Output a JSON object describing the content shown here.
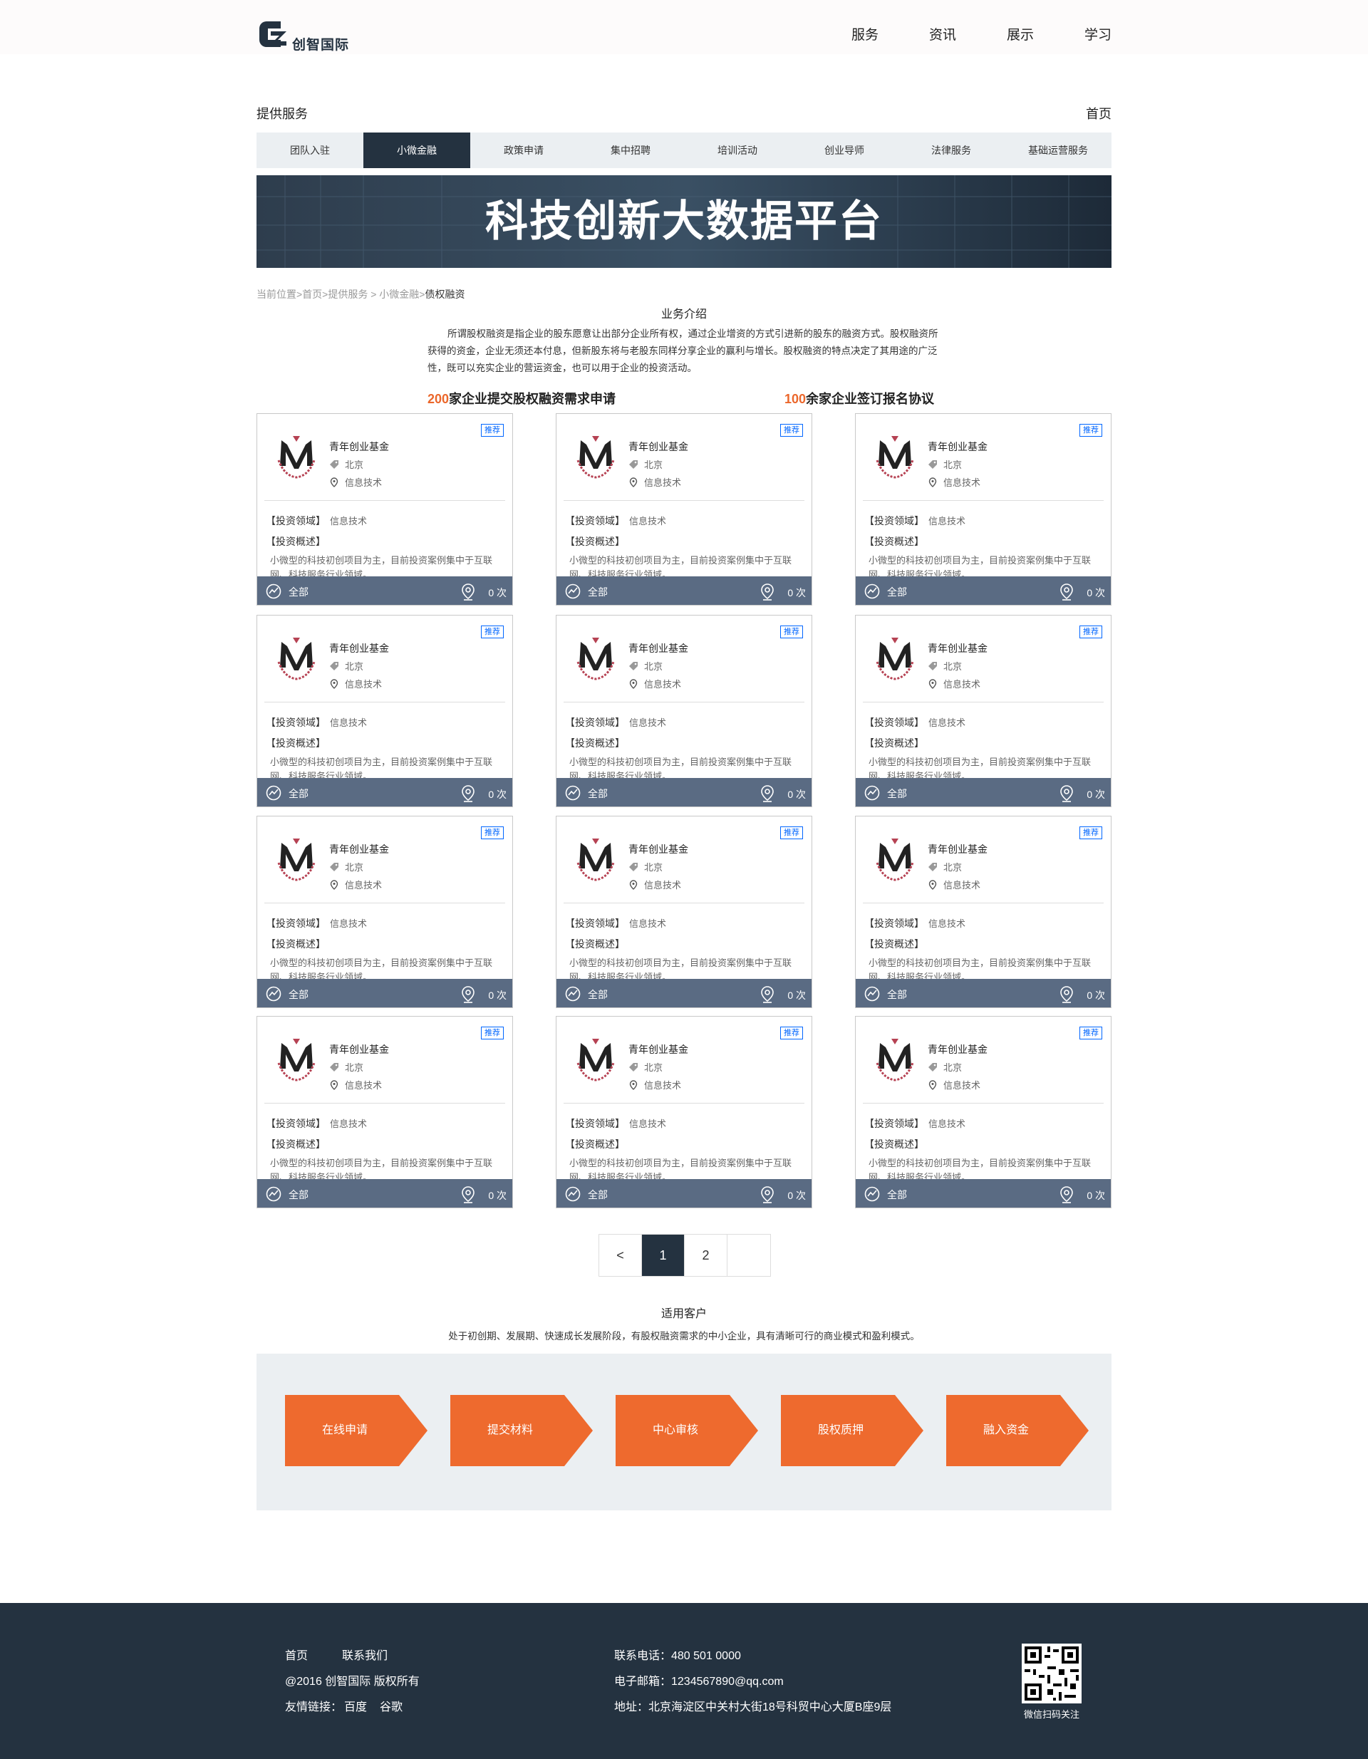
{
  "header": {
    "logo_text": "创智国际",
    "nav": [
      "服务",
      "资讯",
      "展示",
      "学习"
    ]
  },
  "section": {
    "left_label": "提供服务",
    "right_label": "首页"
  },
  "tabs": [
    "团队入驻",
    "小微金融",
    "政策申请",
    "集中招聘",
    "培训活动",
    "创业导师",
    "法律服务",
    "基础运营服务"
  ],
  "banner": {
    "title": "科技创新大数据平台"
  },
  "breadcrumb": {
    "trail": "当前位置>首页>提供服务 > 小微金融>",
    "current": "债权融资"
  },
  "intro": {
    "title": "业务介绍",
    "text": "所谓股权融资是指企业的股东愿意让出部分企业所有权，通过企业增资的方式引进新的股东的融资方式。股权融资所获得的资金，企业无须还本付息，但新股东将与老股东同样分享企业的赢利与增长。股权融资的特点决定了其用途的广泛性，既可以充实企业的营运资金，也可以用于企业的投资活动。"
  },
  "stats": [
    {
      "num": "200",
      "text": "家企业提交股权融资需求申请"
    },
    {
      "num": "100",
      "text": "余家企业签订报名协议"
    }
  ],
  "card": {
    "badge": "推荐",
    "name": "青年创业基金",
    "location": "北京",
    "industry": "信息技术",
    "field_label": "【投资领域】",
    "field_value": "信息技术",
    "overview_label": "【投资概述】",
    "desc": "小微型的科技初创项目为主，目前投资案例集中于互联网、科技服务行业领域。",
    "foot_all": "全部",
    "foot_count": "0 次"
  },
  "pagination": {
    "prev": "<",
    "pages": [
      "1",
      "2"
    ],
    "current": "1"
  },
  "customers": {
    "title": "适用客户",
    "text": "处于初创期、发展期、快速成长发展阶段，有股权融资需求的中小企业，具有清晰可行的商业模式和盈利模式。"
  },
  "process": [
    "在线申请",
    "提交材料",
    "中心审核",
    "股权质押",
    "融入资金"
  ],
  "footer": {
    "links": [
      "首页",
      "联系我们"
    ],
    "copyright": "@2016 创智国际 版权所有",
    "friend_links_label": "友情链接：",
    "friend_links": [
      "百度",
      "谷歌"
    ],
    "phone": "联系电话：480 501 0000",
    "email": "电子邮箱：1234567890@qq.com",
    "address": "地址：北京海淀区中关村大街18号科贸中心大厦B座9层",
    "qr_caption": "微信扫码关注"
  },
  "colors": {
    "header_bg": "#fdfbfb",
    "dark": "#243240",
    "tabs_bg": "#ebeff2",
    "accent_orange": "#eb672b",
    "badge_blue": "#0066ff",
    "card_border": "#999999",
    "card_foot": "#5a6b83",
    "step_orange": "#ee6a2e"
  }
}
